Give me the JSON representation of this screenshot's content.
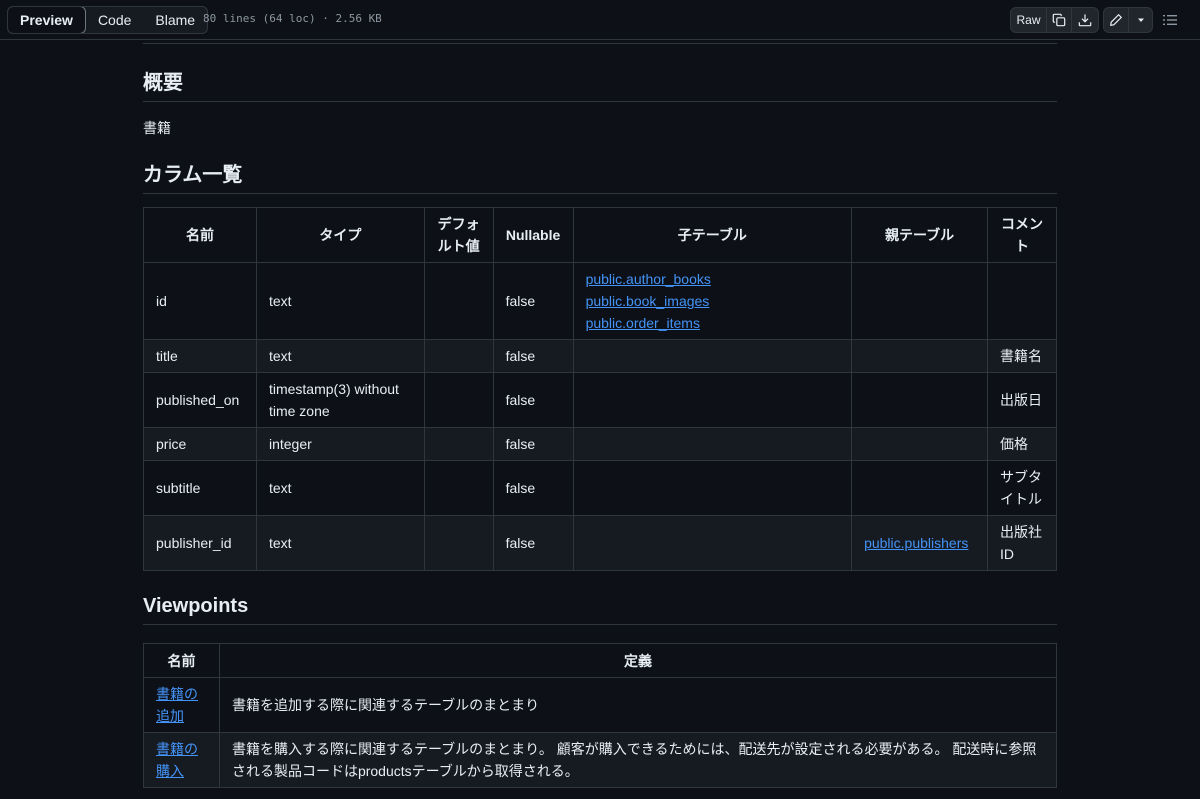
{
  "toolbar": {
    "tabs": [
      "Preview",
      "Code",
      "Blame"
    ],
    "file_info": "80 lines (64 loc) · 2.56 KB",
    "raw_label": "Raw"
  },
  "doc": {
    "overview_heading": "概要",
    "overview_text": "書籍",
    "columns_heading": "カラム一覧",
    "columns_headers": [
      "名前",
      "タイプ",
      "デフォルト値",
      "Nullable",
      "子テーブル",
      "親テーブル",
      "コメント"
    ],
    "rows": [
      {
        "name": "id",
        "type": "text",
        "default": "",
        "nullable": "false",
        "children": [
          "public.author_books",
          "public.book_images",
          "public.order_items"
        ],
        "parent": "",
        "comment": ""
      },
      {
        "name": "title",
        "type": "text",
        "default": "",
        "nullable": "false",
        "children": [],
        "parent": "",
        "comment": "書籍名"
      },
      {
        "name": "published_on",
        "type": "timestamp(3) without time zone",
        "default": "",
        "nullable": "false",
        "children": [],
        "parent": "",
        "comment": "出版日"
      },
      {
        "name": "price",
        "type": "integer",
        "default": "",
        "nullable": "false",
        "children": [],
        "parent": "",
        "comment": "価格"
      },
      {
        "name": "subtitle",
        "type": "text",
        "default": "",
        "nullable": "false",
        "children": [],
        "parent": "",
        "comment": "サブタイトル"
      },
      {
        "name": "publisher_id",
        "type": "text",
        "default": "",
        "nullable": "false",
        "children": [],
        "parent": "public.publishers",
        "comment": "出版社ID"
      }
    ],
    "viewpoints_heading": "Viewpoints",
    "viewpoint_headers": [
      "名前",
      "定義"
    ],
    "viewpoints": [
      {
        "name": "書籍の追加",
        "definition": "書籍を追加する際に関連するテーブルのまとまり"
      },
      {
        "name": "書籍の購入",
        "definition": "書籍を購入する際に関連するテーブルのまとまり。 顧客が購入できるためには、配送先が設定される必要がある。 配送時に参照される製品コードはproductsテーブルから取得される。"
      }
    ]
  }
}
